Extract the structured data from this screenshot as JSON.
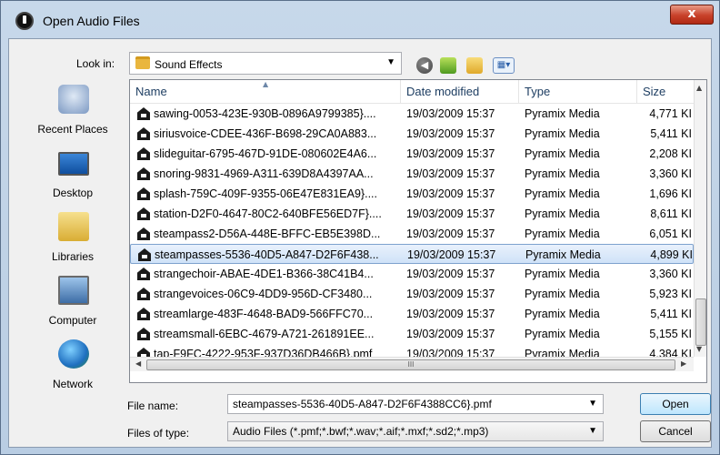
{
  "window": {
    "title": "Open Audio Files",
    "close_symbol": "x"
  },
  "toolbar": {
    "lookin_label": "Look in:",
    "lookin_value": "Sound Effects",
    "icons": [
      "back-icon",
      "up-folder-icon",
      "new-folder-icon",
      "views-menu-icon"
    ]
  },
  "places": [
    {
      "label": "Recent Places",
      "icon": "recent-places-icon"
    },
    {
      "label": "Desktop",
      "icon": "desktop-icon"
    },
    {
      "label": "Libraries",
      "icon": "libraries-icon"
    },
    {
      "label": "Computer",
      "icon": "computer-icon"
    },
    {
      "label": "Network",
      "icon": "network-icon"
    }
  ],
  "columns": {
    "name": "Name",
    "date": "Date modified",
    "type": "Type",
    "size": "Size"
  },
  "files": [
    {
      "name": "sawing-0053-423E-930B-0896A9799385}....",
      "date": "19/03/2009 15:37",
      "type": "Pyramix Media",
      "size": "4,771 KI"
    },
    {
      "name": "siriusvoice-CDEE-436F-B698-29CA0A883...",
      "date": "19/03/2009 15:37",
      "type": "Pyramix Media",
      "size": "5,411 KI"
    },
    {
      "name": "slideguitar-6795-467D-91DE-080602E4A6...",
      "date": "19/03/2009 15:37",
      "type": "Pyramix Media",
      "size": "2,208 KI"
    },
    {
      "name": "snoring-9831-4969-A311-639D8A4397AA...",
      "date": "19/03/2009 15:37",
      "type": "Pyramix Media",
      "size": "3,360 KI"
    },
    {
      "name": "splash-759C-409F-9355-06E47E831EA9}....",
      "date": "19/03/2009 15:37",
      "type": "Pyramix Media",
      "size": "1,696 KI"
    },
    {
      "name": "station-D2F0-4647-80C2-640BFE56ED7F}....",
      "date": "19/03/2009 15:37",
      "type": "Pyramix Media",
      "size": "8,611 KI"
    },
    {
      "name": "steampass2-D56A-448E-BFFC-EB5E398D...",
      "date": "19/03/2009 15:37",
      "type": "Pyramix Media",
      "size": "6,051 KI"
    },
    {
      "name": "steampasses-5536-40D5-A847-D2F6F438...",
      "date": "19/03/2009 15:37",
      "type": "Pyramix Media",
      "size": "4,899 KI",
      "selected": true
    },
    {
      "name": "strangechoir-ABAE-4DE1-B366-38C41B4...",
      "date": "19/03/2009 15:37",
      "type": "Pyramix Media",
      "size": "3,360 KI"
    },
    {
      "name": "strangevoices-06C9-4DD9-956D-CF3480...",
      "date": "19/03/2009 15:37",
      "type": "Pyramix Media",
      "size": "5,923 KI"
    },
    {
      "name": "streamlarge-483F-4648-BAD9-566FFC70...",
      "date": "19/03/2009 15:37",
      "type": "Pyramix Media",
      "size": "5,411 KI"
    },
    {
      "name": "streamsmall-6EBC-4679-A721-261891EE...",
      "date": "19/03/2009 15:37",
      "type": "Pyramix Media",
      "size": "5,155 KI"
    },
    {
      "name": "tap-F9FC-4222-953F-937D36DB466B}.pmf",
      "date": "19/03/2009 15:37",
      "type": "Pyramix Media",
      "size": "4,384 KI"
    }
  ],
  "hscroll_grip": "III",
  "form": {
    "filename_label": "File name:",
    "filename_value": "steampasses-5536-40D5-A847-D2F6F4388CC6}.pmf",
    "filetype_label": "Files of type:",
    "filetype_value": "Audio Files (*.pmf;*.bwf;*.wav;*.aif;*.mxf;*.sd2;*.mp3)",
    "open_label": "Open",
    "cancel_label": "Cancel"
  }
}
